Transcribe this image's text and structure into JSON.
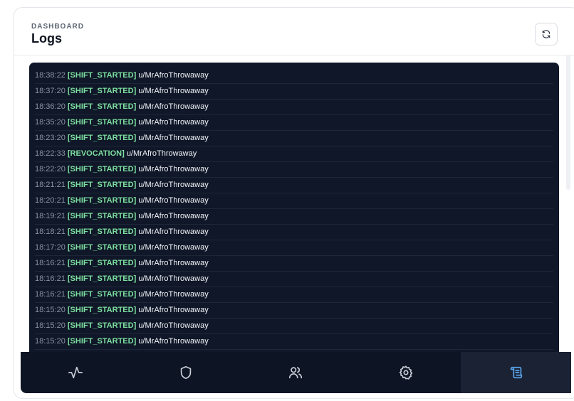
{
  "header": {
    "eyebrow": "DASHBOARD",
    "title": "Logs",
    "refresh_icon": "refresh-icon"
  },
  "logs": [
    {
      "time": "18:38:22",
      "event": "[SHIFT_STARTED]",
      "user": "u/MrAfroThrowaway"
    },
    {
      "time": "18:37:20",
      "event": "[SHIFT_STARTED]",
      "user": "u/MrAfroThrowaway"
    },
    {
      "time": "18:36:20",
      "event": "[SHIFT_STARTED]",
      "user": "u/MrAfroThrowaway"
    },
    {
      "time": "18:35:20",
      "event": "[SHIFT_STARTED]",
      "user": "u/MrAfroThrowaway"
    },
    {
      "time": "18:23:20",
      "event": "[SHIFT_STARTED]",
      "user": "u/MrAfroThrowaway"
    },
    {
      "time": "18:22:33",
      "event": "[REVOCATION]",
      "user": "u/MrAfroThrowaway"
    },
    {
      "time": "18:22:20",
      "event": "[SHIFT_STARTED]",
      "user": "u/MrAfroThrowaway"
    },
    {
      "time": "18:21:21",
      "event": "[SHIFT_STARTED]",
      "user": "u/MrAfroThrowaway"
    },
    {
      "time": "18:20:21",
      "event": "[SHIFT_STARTED]",
      "user": "u/MrAfroThrowaway"
    },
    {
      "time": "18:19:21",
      "event": "[SHIFT_STARTED]",
      "user": "u/MrAfroThrowaway"
    },
    {
      "time": "18:18:21",
      "event": "[SHIFT_STARTED]",
      "user": "u/MrAfroThrowaway"
    },
    {
      "time": "18:17:20",
      "event": "[SHIFT_STARTED]",
      "user": "u/MrAfroThrowaway"
    },
    {
      "time": "18:16:21",
      "event": "[SHIFT_STARTED]",
      "user": "u/MrAfroThrowaway"
    },
    {
      "time": "18:16:21",
      "event": "[SHIFT_STARTED]",
      "user": "u/MrAfroThrowaway"
    },
    {
      "time": "18:16:21",
      "event": "[SHIFT_STARTED]",
      "user": "u/MrAfroThrowaway"
    },
    {
      "time": "18:15:20",
      "event": "[SHIFT_STARTED]",
      "user": "u/MrAfroThrowaway"
    },
    {
      "time": "18:15:20",
      "event": "[SHIFT_STARTED]",
      "user": "u/MrAfroThrowaway"
    },
    {
      "time": "18:15:20",
      "event": "[SHIFT_STARTED]",
      "user": "u/MrAfroThrowaway"
    }
  ],
  "nav": {
    "items": [
      {
        "icon": "activity-icon",
        "active": false
      },
      {
        "icon": "shield-icon",
        "active": false
      },
      {
        "icon": "users-icon",
        "active": false
      },
      {
        "icon": "settings-icon",
        "active": false
      },
      {
        "icon": "scroll-icon",
        "active": true
      }
    ]
  },
  "colors": {
    "console_bg": "#0f1728",
    "event_green": "#7ee0a0",
    "timestamp_gray": "#8b93a3",
    "active_nav_icon": "#5aa8f0",
    "nav_icon": "#c9ced8"
  }
}
